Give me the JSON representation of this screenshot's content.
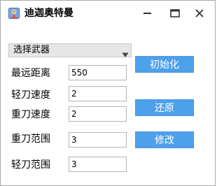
{
  "window": {
    "title": "迪迦奥特曼"
  },
  "weapon_select": {
    "selected": "选择武器"
  },
  "fields": [
    {
      "label": "最远距离",
      "value": "550"
    },
    {
      "label": "轻刀速度",
      "value": "2"
    },
    {
      "label": "重刀速度",
      "value": "2"
    },
    {
      "label": "重刀范围",
      "value": "3"
    },
    {
      "label": "轻刀范围",
      "value": "3"
    }
  ],
  "buttons": {
    "init": "初始化",
    "restore": "还原",
    "modify": "修改"
  },
  "colors": {
    "button_bg": "#4da0ea",
    "button_text": "#ffffff",
    "window_bg": "#ffffff",
    "dropdown_bg": "#e6e6e6"
  },
  "icons": {
    "app": "app-icon",
    "minimize": "minimize-icon",
    "maximize": "maximize-icon",
    "close": "close-icon",
    "dropdown": "chevron-down-icon"
  }
}
